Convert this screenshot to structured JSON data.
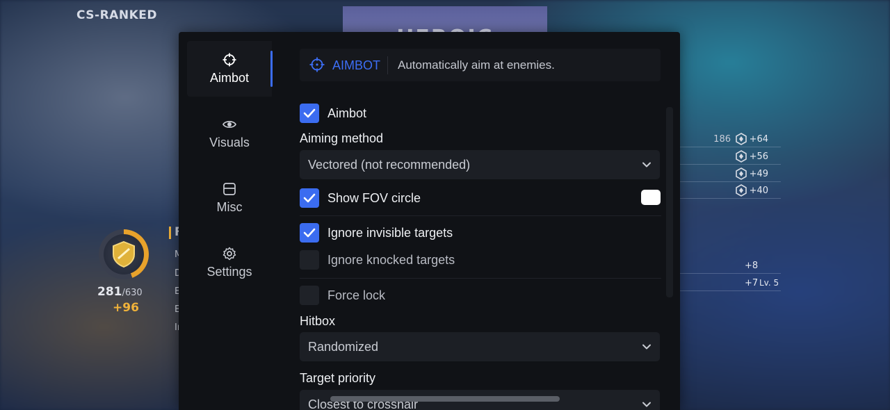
{
  "game": {
    "mode_label": "CS-RANKED",
    "banner_text": "HEROIC",
    "rank": {
      "points": "281",
      "max": "/630",
      "gain": "+96"
    },
    "left_fragments": [
      "F",
      "M",
      "D",
      "E",
      "E",
      "Ir"
    ],
    "stats": [
      {
        "base": "186",
        "gain": "+64"
      },
      {
        "base": "",
        "gain": "+56"
      },
      {
        "base": "",
        "gain": "+49"
      },
      {
        "base": "",
        "gain": "+40"
      }
    ],
    "stats_lower": [
      {
        "gain": "+8",
        "extra": ""
      },
      {
        "gain": "+7",
        "extra": "Lv. 5"
      }
    ]
  },
  "menu": {
    "nav": [
      {
        "label": "Aimbot",
        "icon": "crosshair-icon",
        "active": true
      },
      {
        "label": "Visuals",
        "icon": "eye-icon",
        "active": false
      },
      {
        "label": "Misc",
        "icon": "box-icon",
        "active": false
      },
      {
        "label": "Settings",
        "icon": "gear-icon",
        "active": false
      }
    ],
    "header": {
      "title": "AIMBOT",
      "description": "Automatically aim at enemies."
    },
    "options": {
      "aimbot": {
        "label": "Aimbot",
        "checked": true
      },
      "aiming_method": {
        "label": "Aiming method",
        "value": "Vectored (not recommended)"
      },
      "show_fov": {
        "label": "Show FOV circle",
        "checked": true,
        "swatch_color": "#ffffff"
      },
      "ignore_invisible": {
        "label": "Ignore invisible targets",
        "checked": true
      },
      "ignore_knocked": {
        "label": "Ignore knocked targets",
        "checked": false
      },
      "force_lock": {
        "label": "Force lock",
        "checked": false
      },
      "hitbox": {
        "label": "Hitbox",
        "value": "Randomized"
      },
      "target_priority": {
        "label": "Target priority",
        "value": "Closest to crosshair"
      }
    },
    "colors": {
      "accent": "#3b6cf0",
      "panel": "#101216",
      "field": "#1c1f25"
    }
  }
}
